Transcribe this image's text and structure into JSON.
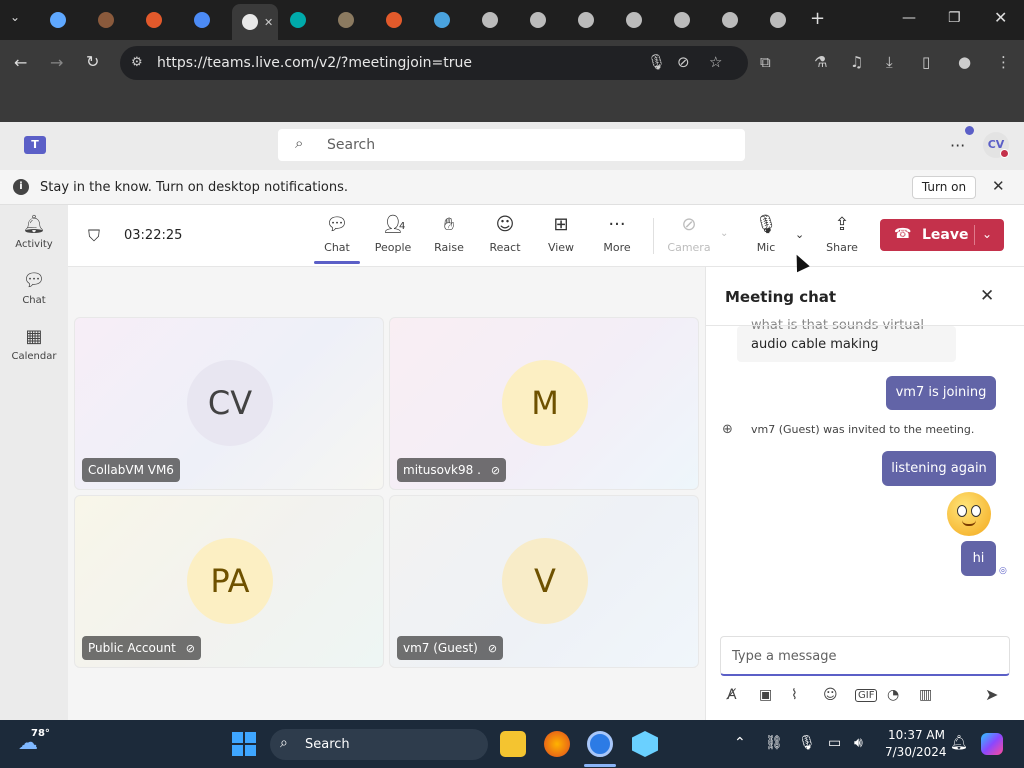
{
  "browser": {
    "url": "https://teams.live.com/v2/?meetingjoin=true",
    "tabs_count": 17,
    "tab_colors": [
      "#5fa8ff",
      "#8a5a3c",
      "#e2592b",
      "#4c8bf5",
      "#e8e8e8",
      "#0aa",
      "#8b7a60",
      "#e25a2b",
      "#4aa3df",
      "#bbb",
      "#bbb",
      "#bbb",
      "#bbb",
      "#bbb",
      "#bbb",
      "#bbb"
    ]
  },
  "teams": {
    "search_placeholder": "Search",
    "avatar_initials": "CV",
    "notification": {
      "text": "Stay in the know. Turn on desktop notifications.",
      "button": "Turn on"
    },
    "rail": [
      {
        "label": "Activity",
        "icon": "bell-icon"
      },
      {
        "label": "Chat",
        "icon": "chat-icon"
      },
      {
        "label": "Calendar",
        "icon": "calendar-icon"
      }
    ]
  },
  "meeting": {
    "timer": "03:22:25",
    "people_count": "4",
    "controls": [
      {
        "label": "Chat",
        "icon": "chat-icon"
      },
      {
        "label": "People",
        "icon": "people-icon"
      },
      {
        "label": "Raise",
        "icon": "hand-icon"
      },
      {
        "label": "React",
        "icon": "smile-icon"
      },
      {
        "label": "View",
        "icon": "grid-icon"
      },
      {
        "label": "More",
        "icon": "more-icon"
      },
      {
        "label": "Camera",
        "icon": "camera-off-icon"
      },
      {
        "label": "Mic",
        "icon": "mic-icon"
      },
      {
        "label": "Share",
        "icon": "share-icon"
      }
    ],
    "leave_label": "Leave",
    "participants": [
      {
        "initials": "CV",
        "name": "CollabVM VM6",
        "muted": false,
        "bg": "#e9e6f3",
        "fg": "#444"
      },
      {
        "initials": "M",
        "name": "mitusovk98 .",
        "muted": true,
        "bg": "#fbefc7",
        "fg": "#7a5a00"
      },
      {
        "initials": "PA",
        "name": "Public Account",
        "muted": true,
        "bg": "#fbefc7",
        "fg": "#7a5a00"
      },
      {
        "initials": "V",
        "name": "vm7 (Guest)",
        "muted": true,
        "bg": "#fbefc7",
        "fg": "#7a5a00"
      }
    ]
  },
  "chat": {
    "title": "Meeting chat",
    "incoming_line1": "what is that sounds virtual",
    "incoming_line2": "audio cable making",
    "out1": "vm7 is joining",
    "system": "vm7 (Guest) was invited to the meeting.",
    "out2": "listening again",
    "out3": "hi",
    "compose_placeholder": "Type a message"
  },
  "taskbar": {
    "temp": "78°",
    "search": "Search",
    "time": "10:37 AM",
    "date": "7/30/2024"
  }
}
